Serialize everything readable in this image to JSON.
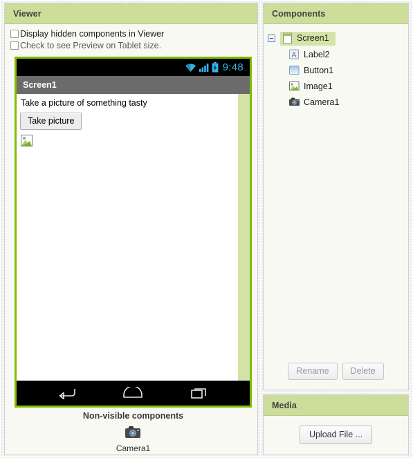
{
  "viewer": {
    "header": "Viewer",
    "checkbox_hidden_label": "Display hidden components in Viewer",
    "checkbox_tablet_label": "Check to see Preview on Tablet size.",
    "phone": {
      "clock": "9:48",
      "title": "Screen1",
      "label_text": "Take a picture of something tasty",
      "button_text": "Take picture",
      "image_icon": "image-placeholder-icon",
      "status_icons": [
        "wifi-icon",
        "signal-icon",
        "battery-charging-icon"
      ],
      "nav_icons": [
        "back-icon",
        "home-icon",
        "recents-icon"
      ]
    },
    "nonvisible": {
      "title": "Non-visible components",
      "items": [
        {
          "name": "Camera1",
          "icon": "camera-icon"
        }
      ]
    }
  },
  "components": {
    "header": "Components",
    "tree": [
      {
        "label": "Screen1",
        "icon": "screen-icon",
        "selected": true,
        "depth": 0,
        "expanded": true
      },
      {
        "label": "Label2",
        "icon": "label-icon",
        "selected": false,
        "depth": 1
      },
      {
        "label": "Button1",
        "icon": "button-icon",
        "selected": false,
        "depth": 1
      },
      {
        "label": "Image1",
        "icon": "image-icon",
        "selected": false,
        "depth": 1
      },
      {
        "label": "Camera1",
        "icon": "camera-icon",
        "selected": false,
        "depth": 1
      }
    ],
    "rename_label": "Rename",
    "delete_label": "Delete"
  },
  "media": {
    "header": "Media",
    "upload_label": "Upload File ..."
  },
  "colors": {
    "panel_header": "#cddd9a",
    "selection": "#d5e3a6",
    "phone_border": "#7fbb00",
    "status_accent": "#33b5e5",
    "titlebar": "#6b6b6b"
  }
}
